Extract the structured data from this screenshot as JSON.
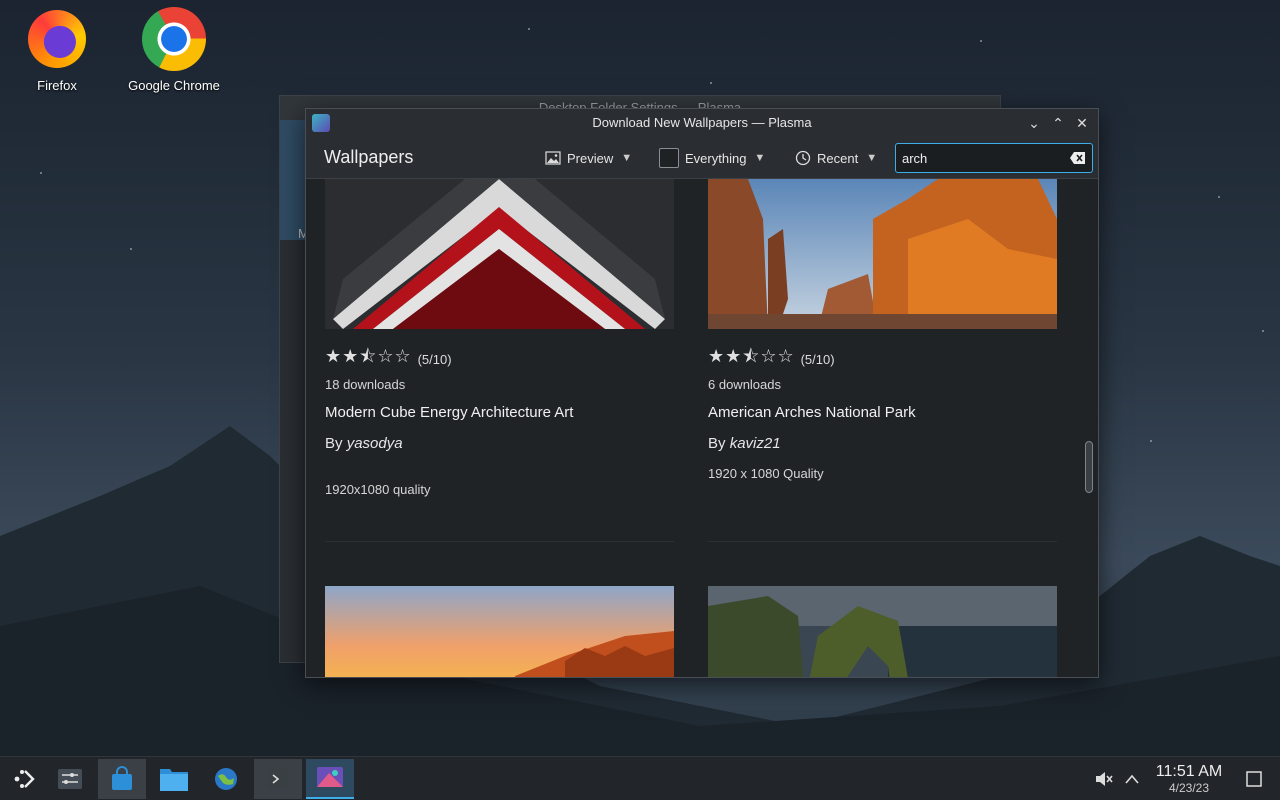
{
  "desktop": {
    "icons": [
      {
        "label": "Firefox"
      },
      {
        "label": "Google Chrome"
      }
    ]
  },
  "background_window": {
    "title": "Desktop Folder Settings — Plasma",
    "fragment": "M"
  },
  "window": {
    "title": "Download New Wallpapers — Plasma",
    "heading": "Wallpapers",
    "toolbar": {
      "view_label": "Preview",
      "filter_label": "Everything",
      "sort_label": "Recent",
      "search_value": "arch"
    },
    "cards": [
      {
        "rating_text": "(5/10)",
        "rating": 5,
        "downloads": "18 downloads",
        "name": "Modern Cube Energy Architecture Art",
        "by_prefix": "By",
        "author": "yasodya",
        "description": "1920x1080 quality"
      },
      {
        "rating_text": "(5/10)",
        "rating": 5,
        "downloads": "6 downloads",
        "name": "American Arches National Park",
        "by_prefix": "By",
        "author": "kaviz21",
        "description": "1920 x 1080 Quality"
      }
    ],
    "scroll_position": 0.55
  },
  "taskbar": {
    "time": "11:51 AM",
    "date": "4/23/23"
  },
  "colors": {
    "accent": "#3daee9",
    "window_bg": "#202326",
    "titlebar_bg": "#2a2e32"
  }
}
